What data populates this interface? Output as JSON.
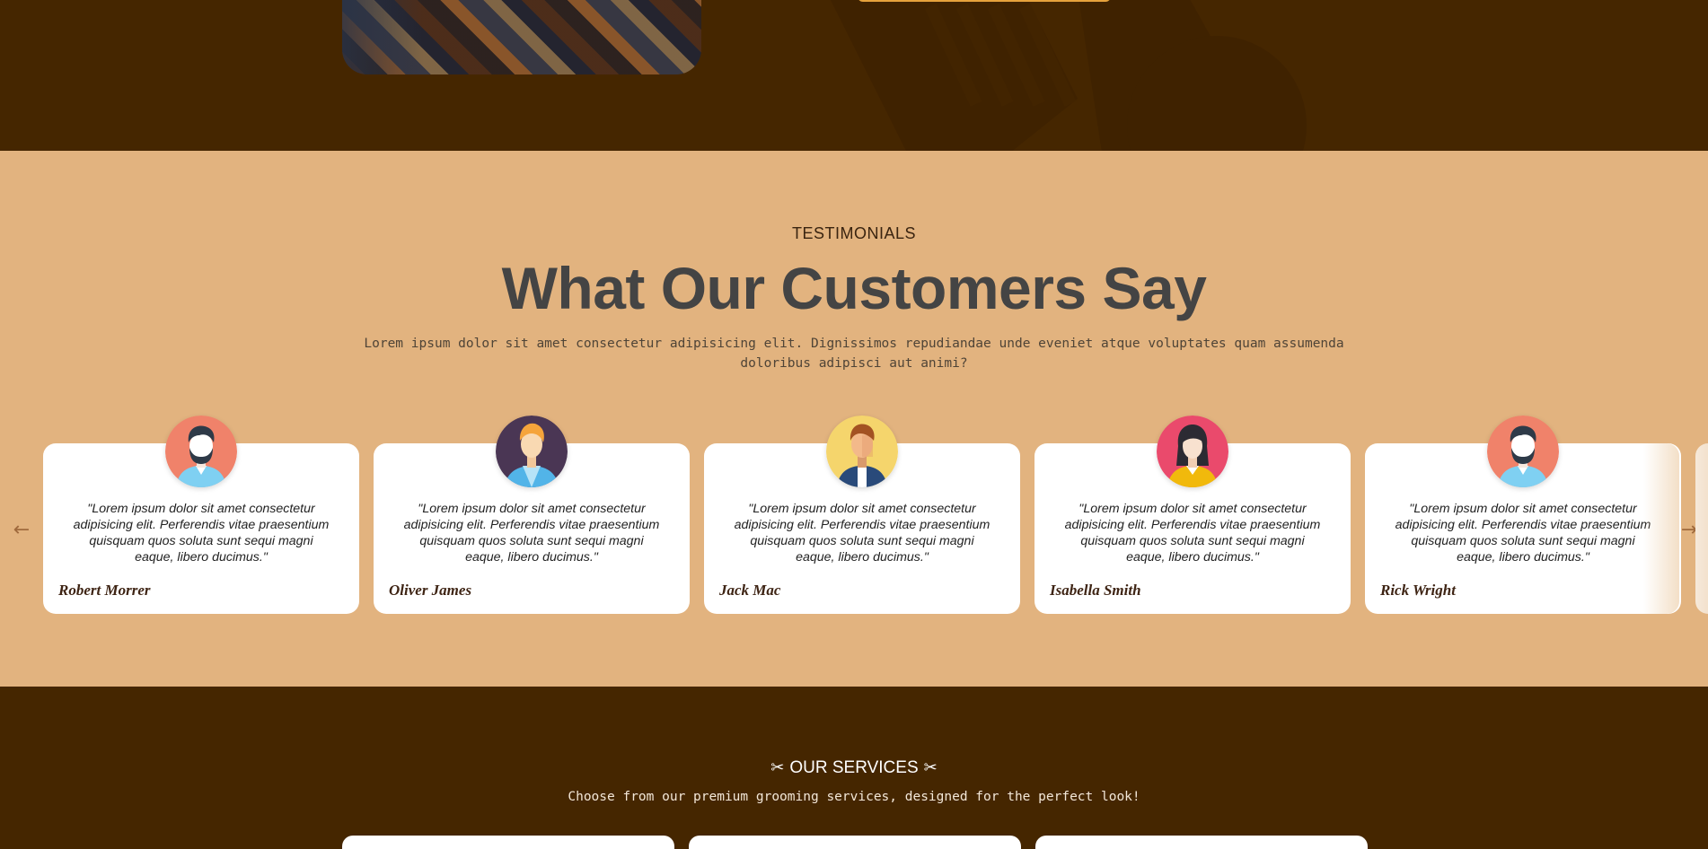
{
  "testimonials": {
    "eyebrow": "TESTIMONIALS",
    "title": "What Our Customers Say",
    "description": "Lorem ipsum dolor sit amet consectetur adipisicing elit. Dignissimos repudiandae unde eveniet atque voluptates quam assumenda doloribus adipisci aut animi?",
    "prev_icon": "arrow-left-icon",
    "next_icon": "arrow-right-icon",
    "cards": [
      {
        "name": "Robert Morrer",
        "quote": "\"Lorem ipsum dolor sit amet consectetur adipisicing elit. Perferendis vitae praesentium quisquam quos soluta sunt sequi magni eaque, libero ducimus.\"",
        "avatar_color": "#f0826a"
      },
      {
        "name": "Oliver James",
        "quote": "\"Lorem ipsum dolor sit amet consectetur adipisicing elit. Perferendis vitae praesentium quisquam quos soluta sunt sequi magni eaque, libero ducimus.\"",
        "avatar_color": "#4a3654"
      },
      {
        "name": "Jack Mac",
        "quote": "\"Lorem ipsum dolor sit amet consectetur adipisicing elit. Perferendis vitae praesentium quisquam quos soluta sunt sequi magni eaque, libero ducimus.\"",
        "avatar_color": "#f5d56c"
      },
      {
        "name": "Isabella Smith",
        "quote": "\"Lorem ipsum dolor sit amet consectetur adipisicing elit. Perferendis vitae praesentium quisquam quos soluta sunt sequi magni eaque, libero ducimus.\"",
        "avatar_color": "#ea4a6c"
      },
      {
        "name": "Rick Wright",
        "quote": "\"Lorem ipsum dolor sit amet consectetur adipisicing elit. Perferendis vitae praesentium quisquam quos soluta sunt sequi magni eaque, libero ducimus.\"",
        "avatar_color": "#f0826a"
      }
    ]
  },
  "services": {
    "title": "OUR SERVICES",
    "icon": "scissors-icon",
    "description": "Choose from our premium grooming services, designed for the perfect look!"
  },
  "colors": {
    "dark_brown": "#452600",
    "tan": "#e2b37f",
    "accent": "#e6a23c"
  }
}
